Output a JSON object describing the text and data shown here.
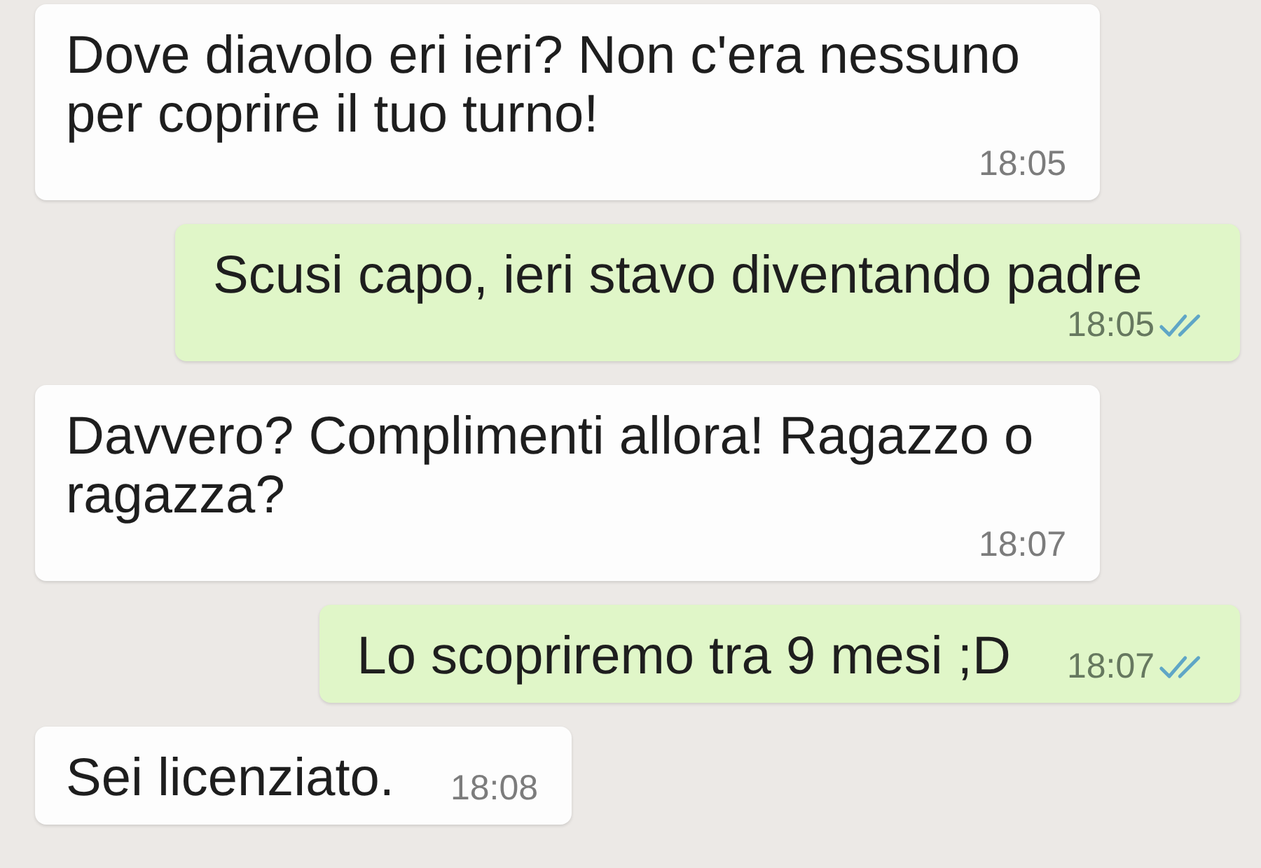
{
  "messages": [
    {
      "kind": "incoming",
      "text": "Dove diavolo eri ieri? Non c'era nessuno per coprire il tuo turno!",
      "time": "18:05"
    },
    {
      "kind": "outgoing",
      "text": "Scusi capo, ieri stavo diventando padre",
      "time": "18:05",
      "read": true
    },
    {
      "kind": "incoming",
      "text": "Davvero? Complimenti allora! Ragazzo o ragazza?",
      "time": "18:07"
    },
    {
      "kind": "outgoing",
      "text": "Lo scopriremo tra 9 mesi ;D",
      "time": "18:07",
      "read": true
    },
    {
      "kind": "incoming",
      "text": "Sei licenziato.",
      "time": "18:08"
    }
  ]
}
